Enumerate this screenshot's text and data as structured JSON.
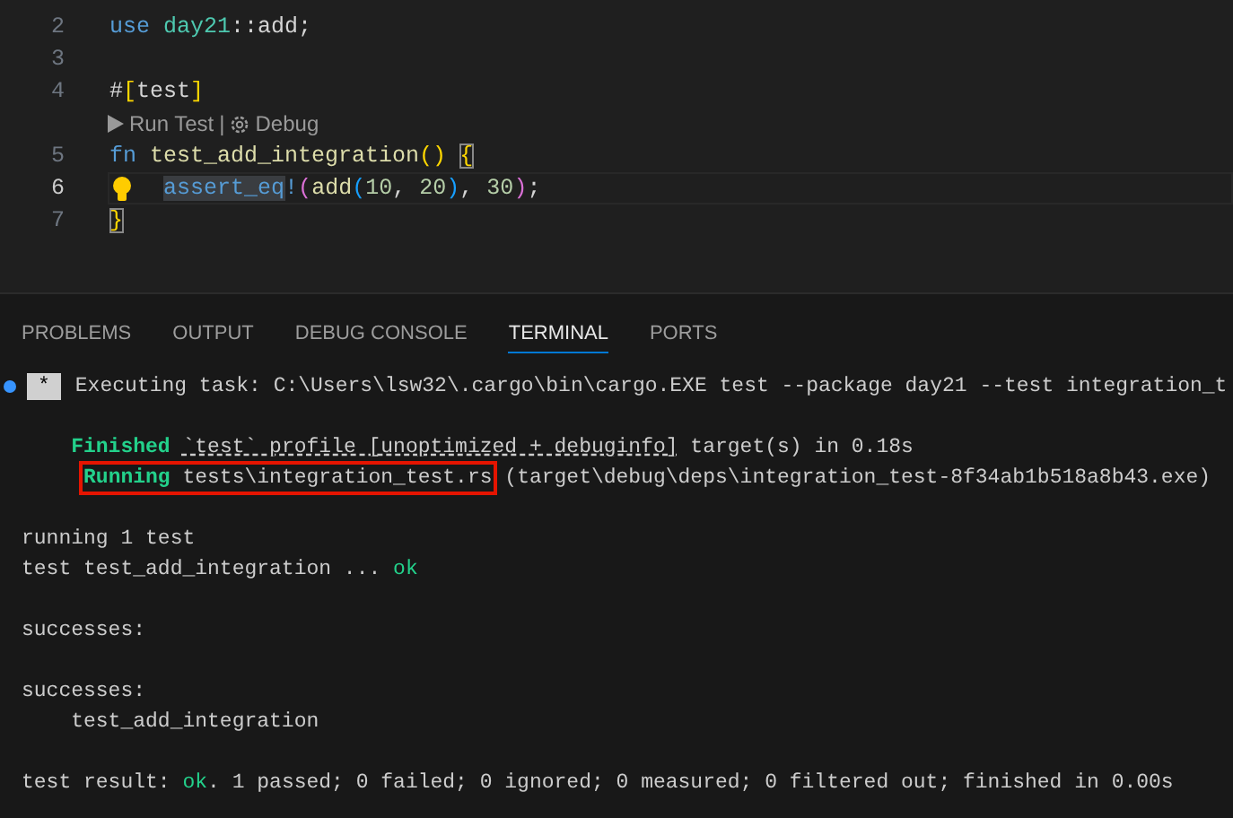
{
  "editor": {
    "lines": [
      {
        "number": "2",
        "active": false,
        "tokens": [
          {
            "text": "use ",
            "kind": "keyword"
          },
          {
            "text": "day21",
            "kind": "module"
          },
          {
            "text": "::add;",
            "kind": "plain"
          }
        ]
      },
      {
        "number": "3",
        "active": false
      },
      {
        "number": "4",
        "active": false,
        "tokens": [
          {
            "text": "#",
            "kind": "plain"
          },
          {
            "text": "[",
            "kind": "bracket1"
          },
          {
            "text": "test",
            "kind": "plain"
          },
          {
            "text": "]",
            "kind": "bracket1"
          }
        ]
      },
      {
        "codelens": {
          "items": [
            {
              "label": "Run Test"
            },
            {
              "label": "Debug"
            }
          ],
          "separator": "|"
        }
      },
      {
        "number": "5",
        "active": false,
        "tokens": [
          {
            "text": "fn ",
            "kind": "keyword"
          },
          {
            "text": "test_add_integration",
            "kind": "function"
          },
          {
            "text": "() ",
            "kind": "bracket1"
          },
          {
            "text": "{",
            "kind": "bracket1",
            "matched": true
          }
        ]
      },
      {
        "number": "6",
        "active": true,
        "lightbulb": true,
        "tokens": [
          {
            "text": "    assert_eq",
            "kind": "macro",
            "highlighted": true
          },
          {
            "text": "!",
            "kind": "macro"
          },
          {
            "text": "(",
            "kind": "bracket2"
          },
          {
            "text": "add",
            "kind": "function"
          },
          {
            "text": "(",
            "kind": "bracket3"
          },
          {
            "text": "10",
            "kind": "number"
          },
          {
            "text": ", ",
            "kind": "plain"
          },
          {
            "text": "20",
            "kind": "number"
          },
          {
            "text": ")",
            "kind": "bracket3"
          },
          {
            "text": ", ",
            "kind": "plain"
          },
          {
            "text": "30",
            "kind": "number"
          },
          {
            "text": ")",
            "kind": "bracket2"
          },
          {
            "text": ";",
            "kind": "plain"
          }
        ]
      },
      {
        "number": "7",
        "active": false,
        "tokens": [
          {
            "text": "}",
            "kind": "bracket1",
            "matched": true
          }
        ]
      }
    ]
  },
  "panel": {
    "tabs": [
      {
        "label": "PROBLEMS",
        "selected": false
      },
      {
        "label": "OUTPUT",
        "selected": false
      },
      {
        "label": "DEBUG CONSOLE",
        "selected": false
      },
      {
        "label": "TERMINAL",
        "selected": true
      },
      {
        "label": "PORTS",
        "selected": false
      }
    ],
    "terminal": {
      "task": {
        "badge": "*",
        "text": "Executing task: C:\\Users\\lsw32\\.cargo\\bin\\cargo.EXE test --package day21 --test integration_t"
      },
      "lines": [
        {
          "kind": "blank"
        },
        {
          "kind": "text",
          "segments": [
            {
              "text": "    Finished",
              "kind": "status"
            },
            {
              "text": " `test` profile [unoptimized + debuginfo]",
              "kind": "text",
              "linked": true
            },
            {
              "text": " target(s) in 0.18s",
              "kind": "text"
            }
          ]
        },
        {
          "kind": "text",
          "segments": [
            {
              "text": "     Running",
              "kind": "status",
              "boxed": true
            },
            {
              "text": " tests\\integration_test.rs",
              "kind": "text",
              "boxed": true
            },
            {
              "text": " (target\\debug\\deps\\integration_test-8f34ab1b518a8b43.exe)",
              "kind": "text"
            }
          ]
        },
        {
          "kind": "blank"
        },
        {
          "kind": "text",
          "segments": [
            {
              "text": "running 1 test",
              "kind": "text"
            }
          ]
        },
        {
          "kind": "text",
          "segments": [
            {
              "text": "test test_add_integration ... ",
              "kind": "text"
            },
            {
              "text": "ok",
              "kind": "success"
            }
          ]
        },
        {
          "kind": "blank"
        },
        {
          "kind": "text",
          "segments": [
            {
              "text": "successes:",
              "kind": "text"
            }
          ]
        },
        {
          "kind": "blank"
        },
        {
          "kind": "text",
          "segments": [
            {
              "text": "successes:",
              "kind": "text"
            }
          ]
        },
        {
          "kind": "text",
          "segments": [
            {
              "text": "    test_add_integration",
              "kind": "text"
            }
          ]
        },
        {
          "kind": "blank"
        },
        {
          "kind": "text",
          "segments": [
            {
              "text": "test result: ",
              "kind": "text"
            },
            {
              "text": "ok",
              "kind": "success"
            },
            {
              "text": ". 1 passed; 0 failed; 0 ignored; 0 measured; 0 filtered out; finished in 0.00s",
              "kind": "text"
            }
          ]
        }
      ]
    }
  }
}
